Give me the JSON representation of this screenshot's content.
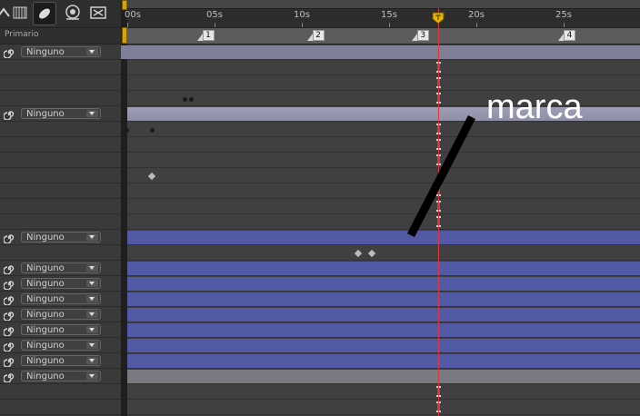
{
  "panel": {
    "header_label": "Primario"
  },
  "ruler": {
    "ticks": [
      {
        "label": "00s",
        "seconds": 0
      },
      {
        "label": "05s",
        "seconds": 5
      },
      {
        "label": "10s",
        "seconds": 10
      },
      {
        "label": "15s",
        "seconds": 15
      },
      {
        "label": "20s",
        "seconds": 20
      },
      {
        "label": "25s",
        "seconds": 25
      }
    ],
    "current_time_seconds": 17.8
  },
  "markers": [
    {
      "label": "1",
      "seconds": 4.3
    },
    {
      "label": "2",
      "seconds": 10.6
    },
    {
      "label": "3",
      "seconds": 16.6
    },
    {
      "label": "4",
      "seconds": 25.0
    }
  ],
  "layers": [
    {
      "parent": "Ninguno",
      "bar": "lav"
    },
    {
      "parent": "",
      "bar": ""
    },
    {
      "parent": "",
      "bar": ""
    },
    {
      "parent": "",
      "bar": ""
    },
    {
      "parent": "Ninguno",
      "bar": "lav2"
    },
    {
      "parent": "",
      "bar": ""
    },
    {
      "parent": "",
      "bar": ""
    },
    {
      "parent": "",
      "bar": ""
    },
    {
      "parent": "",
      "bar": ""
    },
    {
      "parent": "",
      "bar": ""
    },
    {
      "parent": "",
      "bar": ""
    },
    {
      "parent": "",
      "bar": ""
    },
    {
      "parent": "Ninguno",
      "bar": "blue"
    },
    {
      "parent": "",
      "bar": ""
    },
    {
      "parent": "Ninguno",
      "bar": "blue"
    },
    {
      "parent": "Ninguno",
      "bar": "blue"
    },
    {
      "parent": "Ninguno",
      "bar": "blue"
    },
    {
      "parent": "Ninguno",
      "bar": "blue"
    },
    {
      "parent": "Ninguno",
      "bar": "blue"
    },
    {
      "parent": "Ninguno",
      "bar": "blue"
    },
    {
      "parent": "Ninguno",
      "bar": "blue"
    },
    {
      "parent": "Ninguno",
      "bar": "gray"
    },
    {
      "parent": "",
      "bar": ""
    },
    {
      "parent": "",
      "bar": ""
    }
  ],
  "annotation": {
    "text": "marca"
  },
  "colors": {
    "cti": "#d63a3a",
    "layer_blue": "#525aa6",
    "layer_lavender": "#7f8097",
    "marker_bracket": "#d8a400"
  }
}
